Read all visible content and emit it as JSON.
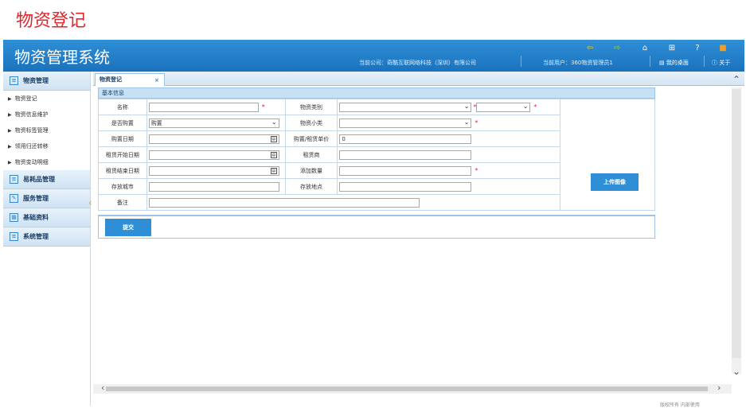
{
  "page_title": "物资登记",
  "app": {
    "title": "物资管理系统",
    "company": "当前公司：奇酷互联网络科技（深圳）有限公司",
    "user": "当前用户：360物资管理员1",
    "desk_label": "我的桌面",
    "about_label": "关于"
  },
  "sidebar": {
    "groups": [
      {
        "label": "物资管理",
        "items": [
          "物资登记",
          "物资信息维护",
          "物资标签管理",
          "领用归还转移",
          "物资变动明细"
        ]
      },
      {
        "label": "易耗品管理",
        "items": []
      },
      {
        "label": "服务管理",
        "items": []
      },
      {
        "label": "基础资料",
        "items": []
      },
      {
        "label": "系统管理",
        "items": []
      }
    ]
  },
  "tab": {
    "label": "物资登记",
    "close": "×"
  },
  "form": {
    "section": "基本信息",
    "labels": {
      "name": "名称",
      "category": "物资类别",
      "is_purchase": "是否购置",
      "subcategory": "物资小类",
      "purchase_date": "购置日期",
      "unit_price": "购置/租赁单价",
      "lease_start": "租赁开始日期",
      "lessor": "租赁商",
      "lease_end": "租赁结束日期",
      "add_quantity": "添加数量",
      "city": "存放城市",
      "location": "存放地点",
      "remark": "备注"
    },
    "values": {
      "is_purchase": "购置",
      "unit_price": "0"
    },
    "upload_label": "上传图像",
    "submit_label": "提交"
  },
  "footer": "版权所有 内部使用"
}
